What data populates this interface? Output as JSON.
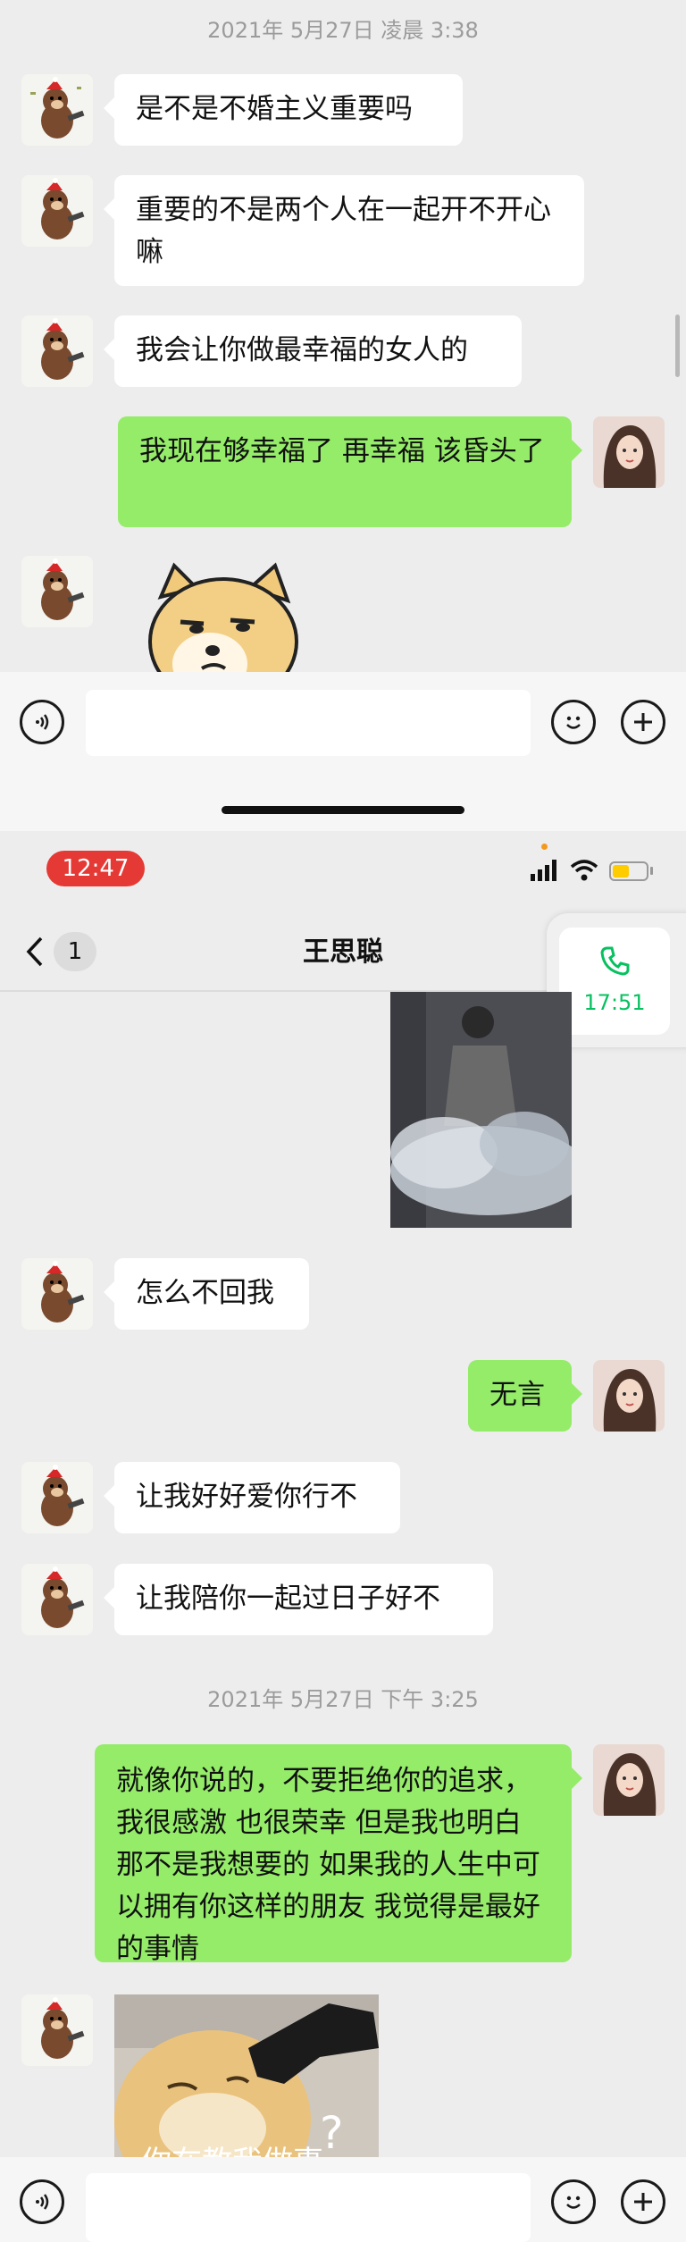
{
  "part1": {
    "timestamp": "2021年 5月27日 凌晨 3:38",
    "messages": [
      {
        "text": "是不是不婚主义重要吗"
      },
      {
        "text": "重要的不是两个人在一起开不开心嘛"
      },
      {
        "text": "我会让你做最幸福的女人的"
      },
      {
        "text": "我现在够幸福了 再幸福 该昏头了"
      }
    ]
  },
  "status": {
    "time": "12:47"
  },
  "header": {
    "back_count": "1",
    "title": "王思聪",
    "call_time": "17:51"
  },
  "part2": {
    "messages": [
      {
        "text": "怎么不回我"
      },
      {
        "text": "无言"
      },
      {
        "text": "让我好好爱你行不"
      },
      {
        "text": "让我陪你一起过日子好不"
      }
    ],
    "timestamp": "2021年 5月27日 下午 3:25",
    "long_message": "就像你说的，不要拒绝你的追求，我很感激 也很荣幸 但是我也明白 那不是我想要的 如果我的人生中可以拥有你这样的朋友 我觉得是最好的事情",
    "sticker_caption": "你在教我做事"
  },
  "colors": {
    "outgoing": "#95ec69",
    "incoming": "#ffffff",
    "background": "#ededed",
    "status_time_pill": "#e53935",
    "call_green": "#07c160"
  }
}
